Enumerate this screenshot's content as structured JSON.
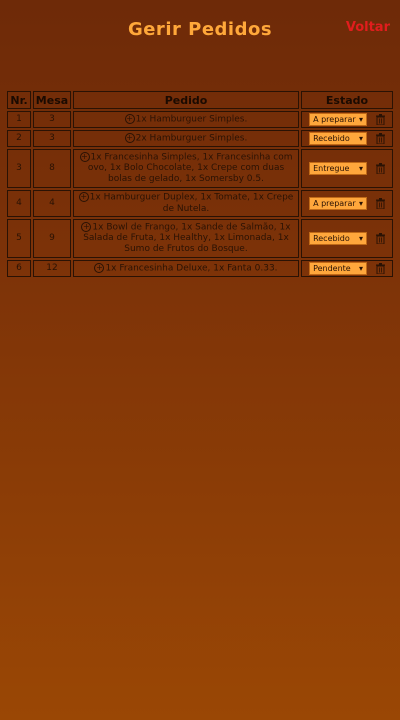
{
  "header": {
    "title": "Gerir Pedidos",
    "back_label": "Voltar"
  },
  "table": {
    "columns": [
      "Nr.",
      "Mesa",
      "Pedido",
      "Estado"
    ],
    "rows": [
      {
        "nr": "1",
        "mesa": "3",
        "pedido": "1x Hamburguer Simples.",
        "estado": "A preparar"
      },
      {
        "nr": "2",
        "mesa": "3",
        "pedido": "2x Hamburguer Simples.",
        "estado": "Recebido"
      },
      {
        "nr": "3",
        "mesa": "8",
        "pedido": "1x Francesinha Simples, 1x Francesinha com ovo, 1x Bolo Chocolate, 1x Crepe com duas bolas de gelado, 1x Somersby 0.5.",
        "estado": "Entregue"
      },
      {
        "nr": "4",
        "mesa": "4",
        "pedido": "1x Hamburguer Duplex, 1x Tomate, 1x Crepe de Nutela.",
        "estado": "A preparar"
      },
      {
        "nr": "5",
        "mesa": "9",
        "pedido": "1x Bowl de Frango, 1x Sande de Salmão, 1x Salada de Fruta, 1x Healthy, 1x Limonada, 1x Sumo de Frutos do Bosque.",
        "estado": "Recebido"
      },
      {
        "nr": "6",
        "mesa": "12",
        "pedido": "1x Francesinha Deluxe, 1x Fanta 0.33.",
        "estado": "Pendente"
      }
    ]
  },
  "icons": {
    "expand": "plus-circle-icon",
    "delete": "trash-icon",
    "dropdown": "chevron-down-icon"
  },
  "colors": {
    "title": "#ffa83a",
    "back": "#e11d1d",
    "select_bg": "#ffa73c",
    "border": "#2a1204"
  }
}
